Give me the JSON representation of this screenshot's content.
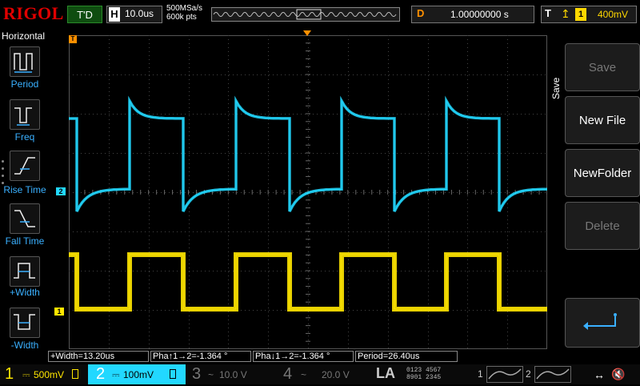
{
  "brand": "RIGOL",
  "top": {
    "trigger_status": "T'D",
    "horizontal_label": "H",
    "timebase": "10.0us",
    "sample_rate": "500MSa/s",
    "memory_depth": "600k pts",
    "delay_label": "D",
    "delay_value": "1.00000000 s",
    "trigger_label": "T",
    "trigger_source": "1",
    "trigger_level": "400mV"
  },
  "left_menu": {
    "title": "Horizontal",
    "items": [
      {
        "label": "Period",
        "icon": "period-icon"
      },
      {
        "label": "Freq",
        "icon": "frequency-icon"
      },
      {
        "label": "Rise Time",
        "icon": "rise-time-icon"
      },
      {
        "label": "Fall Time",
        "icon": "fall-time-icon"
      },
      {
        "label": "+Width",
        "icon": "positive-width-icon"
      },
      {
        "label": "-Width",
        "icon": "negative-width-icon"
      }
    ]
  },
  "right_menu": {
    "title": "Save",
    "items": [
      {
        "label": "Save",
        "enabled": false
      },
      {
        "label": "New File",
        "enabled": true
      },
      {
        "label": "NewFolder",
        "enabled": true
      },
      {
        "label": "Delete",
        "enabled": false
      }
    ],
    "return_icon": "return-arrow-icon"
  },
  "markers": {
    "ch1": "1",
    "ch2": "2",
    "trigger_time": "T",
    "trigger_level": "T"
  },
  "measurements": [
    "+Width=13.20us",
    "Pha↑1→2=-1.364 °",
    "Pha↓1→2=-1.364 °",
    "Period=26.40us"
  ],
  "bottom": {
    "channels": [
      {
        "num": "1",
        "scale": "500mV",
        "color": "#ffe600",
        "active": true
      },
      {
        "num": "2",
        "scale": "100mV",
        "color": "#22d8ff",
        "active": true
      },
      {
        "num": "3",
        "scale": "10.0 V",
        "color": "#777777",
        "active": false
      },
      {
        "num": "4",
        "scale": "20.0 V",
        "color": "#777777",
        "active": false
      }
    ],
    "la": "LA",
    "la_digits_top": "0123 4567",
    "la_digits_bottom": "8901 2345"
  },
  "colors": {
    "ch1": "#ffe600",
    "ch2": "#22d8ff",
    "accent": "#ff9000",
    "menu_label": "#3ab0ff"
  }
}
